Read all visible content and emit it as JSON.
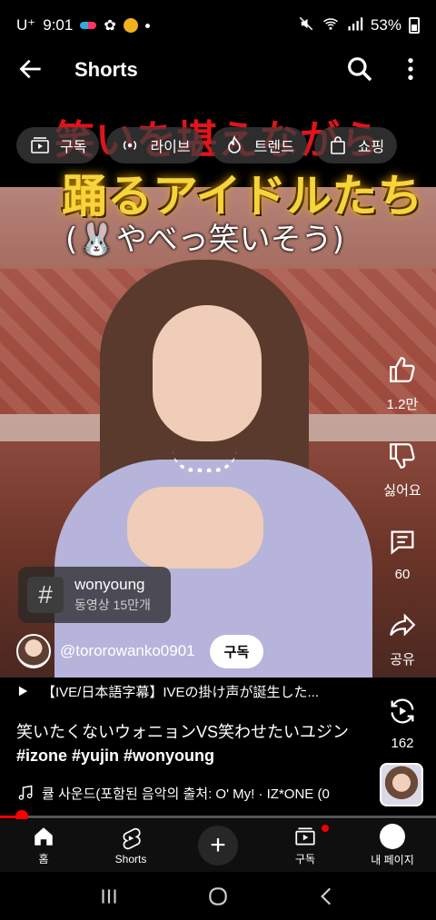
{
  "status_bar": {
    "carrier": "U⁺",
    "time": "9:01",
    "battery": "53%"
  },
  "overlay_title": {
    "line1": "笑いを堪えながら",
    "line2": "踊るアイドルたち"
  },
  "top_bar": {
    "title": "Shorts"
  },
  "chips": [
    {
      "label": "구독",
      "icon": "subscriptions-icon"
    },
    {
      "label": "라이브",
      "icon": "live-icon"
    },
    {
      "label": "트렌드",
      "icon": "trending-icon"
    },
    {
      "label": "쇼핑",
      "icon": "shopping-bag-icon"
    }
  ],
  "video": {
    "caption": "(🐰やべっ笑いそう)",
    "progress": 0.05
  },
  "actions": {
    "like_count": "1.2만",
    "dislike_label": "싫어요",
    "comment_count": "60",
    "share_label": "공유",
    "remix_count": "162"
  },
  "hashtag_card": {
    "symbol": "#",
    "name": "wonyoung",
    "count": "동영상 15만개"
  },
  "channel": {
    "handle": "@tororowanko0901",
    "subscribe_label": "구독"
  },
  "related_video": "【IVE/日本語字幕】IVEの掛け声が誕生した...",
  "video_title": {
    "text": "笑いたくないウォニョンVS笑わせたいユジン",
    "tags": "#izone #yujin #wonyoung"
  },
  "sound": {
    "text": "큘 사운드(포함된 음악의 출처: O' My! · IZ*ONE (0"
  },
  "bottom_nav": {
    "home": "홈",
    "shorts": "Shorts",
    "subscriptions": "구독",
    "you": "내 페이지"
  },
  "colors": {
    "accent_red": "#ff0000",
    "overlay_red": "#e1141a",
    "overlay_yellow": "#f6d43b"
  }
}
